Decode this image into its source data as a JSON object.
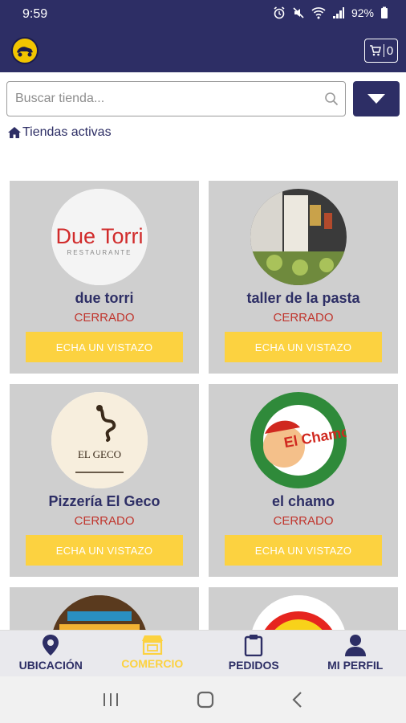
{
  "status_bar": {
    "time": "9:59",
    "battery": "92%"
  },
  "header": {
    "cart_count": "0",
    "logo_icon": "brand-logo-icon",
    "cart_icon": "cart-icon"
  },
  "search": {
    "placeholder": "Buscar tienda...",
    "value": ""
  },
  "breadcrumb": {
    "label": "Tiendas activas"
  },
  "stores": [
    {
      "name": "due torri",
      "status": "CERRADO",
      "button": "ECHA UN VISTAZO",
      "logo_text": "Due Torri",
      "logo_sub": "RESTAURANTE"
    },
    {
      "name": "taller de la pasta",
      "status": "CERRADO",
      "button": "ECHA UN VISTAZO"
    },
    {
      "name": "Pizzería El Geco",
      "status": "CERRADO",
      "button": "ECHA UN VISTAZO",
      "logo_text": "EL GECO"
    },
    {
      "name": "el chamo",
      "status": "CERRADO",
      "button": "ECHA UN VISTAZO",
      "logo_text": "El Chamo"
    },
    {
      "name": "",
      "status": "",
      "button": ""
    },
    {
      "name": "",
      "status": "",
      "button": ""
    }
  ],
  "bottom_nav": [
    {
      "label": "UBICACIÓN",
      "icon": "location-pin-icon",
      "active": false
    },
    {
      "label": "COMERCIO",
      "icon": "store-icon",
      "active": true
    },
    {
      "label": "PEDIDOS",
      "icon": "clipboard-icon",
      "active": false
    },
    {
      "label": "MI PERFIL",
      "icon": "person-icon",
      "active": false
    }
  ],
  "colors": {
    "primary": "#2d2e65",
    "accent": "#fcd240",
    "status_closed": "#c0352d",
    "card_bg": "#cfcfcf"
  }
}
